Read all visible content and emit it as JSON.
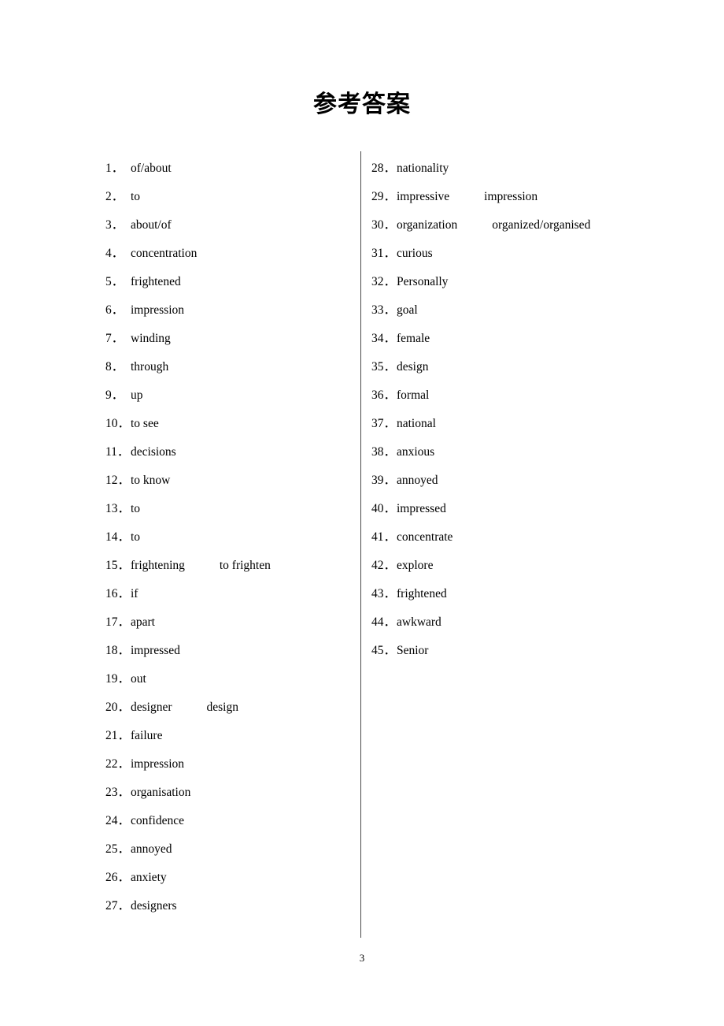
{
  "document": {
    "title": "参考答案",
    "page_number": "3"
  },
  "columns": {
    "left": [
      {
        "num": "1．",
        "answer": "of/about",
        "alt": ""
      },
      {
        "num": "2．",
        "answer": "to",
        "alt": ""
      },
      {
        "num": "3．",
        "answer": "about/of",
        "alt": ""
      },
      {
        "num": "4．",
        "answer": "concentration",
        "alt": ""
      },
      {
        "num": "5．",
        "answer": "frightened",
        "alt": ""
      },
      {
        "num": "6．",
        "answer": "impression",
        "alt": ""
      },
      {
        "num": "7．",
        "answer": "winding",
        "alt": ""
      },
      {
        "num": "8．",
        "answer": "through",
        "alt": ""
      },
      {
        "num": "9．",
        "answer": "up",
        "alt": ""
      },
      {
        "num": "10．",
        "answer": "to see",
        "alt": ""
      },
      {
        "num": "11．",
        "answer": "decisions",
        "alt": ""
      },
      {
        "num": "12．",
        "answer": "to know",
        "alt": ""
      },
      {
        "num": "13．",
        "answer": "to",
        "alt": ""
      },
      {
        "num": "14．",
        "answer": "to",
        "alt": ""
      },
      {
        "num": "15．",
        "answer": "frightening",
        "alt": "to frighten"
      },
      {
        "num": "16．",
        "answer": "if",
        "alt": ""
      },
      {
        "num": "17．",
        "answer": "apart",
        "alt": ""
      },
      {
        "num": "18．",
        "answer": "impressed",
        "alt": ""
      },
      {
        "num": "19．",
        "answer": "out",
        "alt": ""
      },
      {
        "num": "20．",
        "answer": "designer",
        "alt": "design"
      },
      {
        "num": "21．",
        "answer": "failure",
        "alt": ""
      },
      {
        "num": "22．",
        "answer": "impression",
        "alt": ""
      },
      {
        "num": "23．",
        "answer": "organisation",
        "alt": ""
      },
      {
        "num": "24．",
        "answer": "confidence",
        "alt": ""
      },
      {
        "num": "25．",
        "answer": "annoyed",
        "alt": ""
      },
      {
        "num": "26．",
        "answer": "anxiety",
        "alt": ""
      },
      {
        "num": "27．",
        "answer": "designers",
        "alt": ""
      }
    ],
    "right": [
      {
        "num": "28．",
        "answer": "nationality",
        "alt": ""
      },
      {
        "num": "29．",
        "answer": "impressive",
        "alt": "impression"
      },
      {
        "num": "30．",
        "answer": "organization",
        "alt": "organized/organised"
      },
      {
        "num": "31．",
        "answer": "curious",
        "alt": ""
      },
      {
        "num": "32．",
        "answer": "Personally",
        "alt": ""
      },
      {
        "num": "33．",
        "answer": "goal",
        "alt": ""
      },
      {
        "num": "34．",
        "answer": "female",
        "alt": ""
      },
      {
        "num": "35．",
        "answer": "design",
        "alt": ""
      },
      {
        "num": "36．",
        "answer": "formal",
        "alt": ""
      },
      {
        "num": "37．",
        "answer": "national",
        "alt": ""
      },
      {
        "num": "38．",
        "answer": "anxious",
        "alt": ""
      },
      {
        "num": "39．",
        "answer": "annoyed",
        "alt": ""
      },
      {
        "num": "40．",
        "answer": "impressed",
        "alt": ""
      },
      {
        "num": "41．",
        "answer": "concentrate",
        "alt": ""
      },
      {
        "num": "42．",
        "answer": "explore",
        "alt": ""
      },
      {
        "num": "43．",
        "answer": "frightened",
        "alt": ""
      },
      {
        "num": "44．",
        "answer": "awkward",
        "alt": ""
      },
      {
        "num": "45．",
        "answer": "Senior",
        "alt": ""
      }
    ]
  }
}
